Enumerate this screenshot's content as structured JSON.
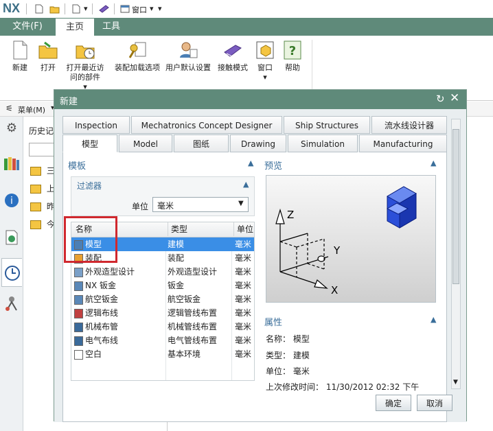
{
  "app": {
    "logo": "NX"
  },
  "quick_access": {
    "window_label": "窗口"
  },
  "ribbon_tabs": [
    {
      "label": "文件(F)"
    },
    {
      "label": "主页"
    },
    {
      "label": "工具"
    }
  ],
  "ribbon_buttons": [
    {
      "label": "新建"
    },
    {
      "label": "打开"
    },
    {
      "label": "打开最近访问的部件"
    },
    {
      "label": "装配加载选项"
    },
    {
      "label": "用户默认设置"
    },
    {
      "label": "接触模式"
    },
    {
      "label": "窗口"
    },
    {
      "label": "帮助"
    }
  ],
  "menu_row": {
    "menu_label": "菜单(M)"
  },
  "navigator": {
    "title": "历史记",
    "folders": [
      "三",
      "上",
      "昨",
      "今"
    ]
  },
  "dialog": {
    "title": "新建",
    "tabs_row1": [
      "Inspection",
      "Mechatronics Concept Designer",
      "Ship Structures",
      "流水线设计器"
    ],
    "tabs_row2": [
      "模型",
      "Model",
      "图纸",
      "Drawing",
      "Simulation",
      "Manufacturing"
    ],
    "template_section": "模板",
    "filter_section": "过滤器",
    "unit_label": "单位",
    "unit_value": "毫米",
    "columns": [
      "名称",
      "类型",
      "单位"
    ],
    "rows": [
      {
        "name": "模型",
        "type": "建模",
        "unit": "毫米"
      },
      {
        "name": "装配",
        "type": "装配",
        "unit": "毫米"
      },
      {
        "name": "外观造型设计",
        "type": "外观造型设计",
        "unit": "毫米"
      },
      {
        "name": "NX 钣金",
        "type": "钣金",
        "unit": "毫米"
      },
      {
        "name": "航空钣金",
        "type": "航空钣金",
        "unit": "毫米"
      },
      {
        "name": "逻辑布线",
        "type": "逻辑管线布置",
        "unit": "毫米"
      },
      {
        "name": "机械布管",
        "type": "机械管线布置",
        "unit": "毫米"
      },
      {
        "name": "电气布线",
        "type": "电气管线布置",
        "unit": "毫米"
      },
      {
        "name": "空白",
        "type": "基本环境",
        "unit": "毫米"
      }
    ],
    "preview_section": "预览",
    "axis_labels": {
      "z": "Z",
      "y": "Y",
      "x": "X"
    },
    "properties_section": "属性",
    "properties": {
      "name": "名称： 模型",
      "type": "类型： 建模",
      "unit": "单位： 毫米",
      "modified": "上次修改时间： 11/30/2012 02:32 下午"
    },
    "ok_label": "确定",
    "cancel_label": "取消"
  },
  "colors": {
    "title_bar": "#5f8a7a",
    "selection": "#3a8ee6",
    "highlight_box": "#d0282e"
  }
}
